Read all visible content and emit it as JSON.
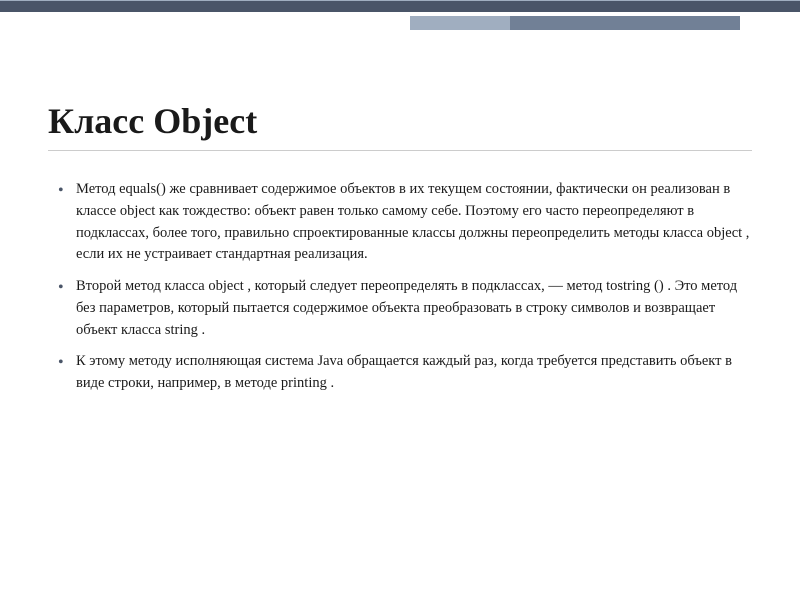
{
  "slide": {
    "title": "Класс Object",
    "bullets": [
      "Метод equals() же сравнивает содержимое объектов в их текущем состоянии, фактически он реализован в классе object как тождество: объект равен только самому себе. Поэтому его часто переопределяют в подклассах, более того, правильно спроектированные классы должны переопределить методы класса object , если их не устраивает стандартная реализация.",
      "Второй метод класса object , который следует переопределять в подклассах, — метод tostring () . Это метод без параметров, который пытается содержимое объекта преобразовать в строку символов и возвращает объект класса string .",
      "К этому методу исполняющая система Java обращается каждый раз, когда требуется представить объект в виде строки, например, в методе printing ."
    ]
  }
}
